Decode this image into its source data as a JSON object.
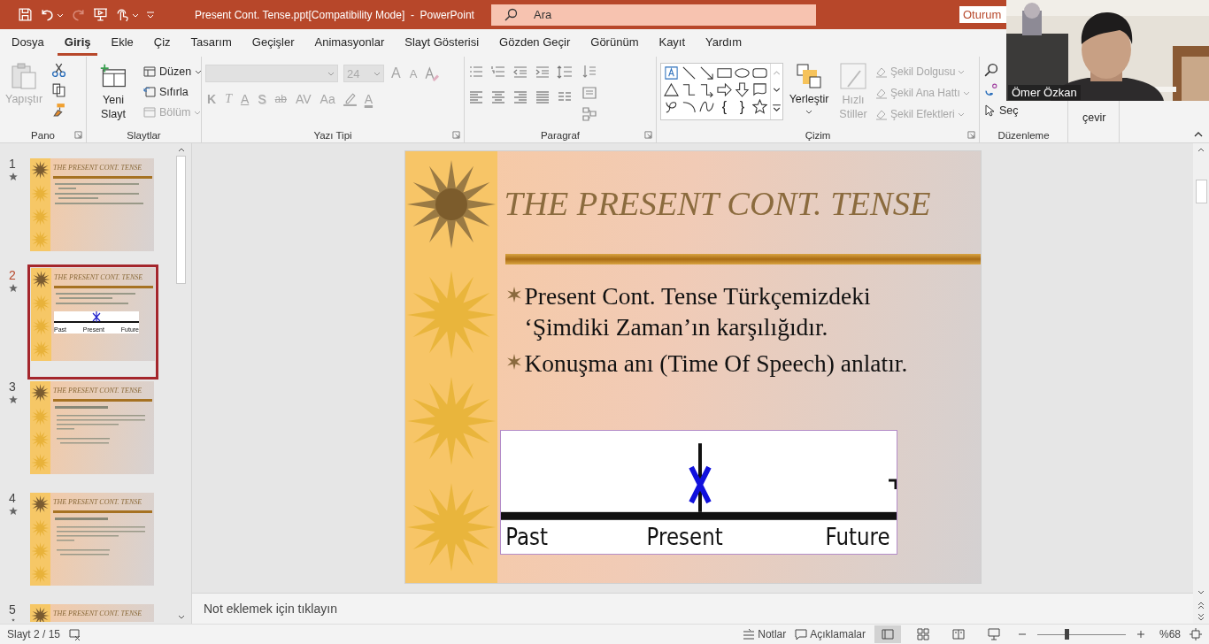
{
  "title_bar": {
    "document_title": "Present Cont. Tense.ppt[Compatibility Mode]  -  PowerPoint",
    "search": {
      "placeholder": "Ara"
    },
    "sign_in": "Oturum"
  },
  "webcam": {
    "kind": "picture",
    "name": "Ömer Özkan"
  },
  "tabs": [
    {
      "label": "Dosya",
      "selected": false
    },
    {
      "label": "Giriş",
      "selected": true
    },
    {
      "label": "Ekle",
      "selected": false
    },
    {
      "label": "Çiz",
      "selected": false
    },
    {
      "label": "Tasarım",
      "selected": false
    },
    {
      "label": "Geçişler",
      "selected": false
    },
    {
      "label": "Animasyonlar",
      "selected": false
    },
    {
      "label": "Slayt Gösterisi",
      "selected": false
    },
    {
      "label": "Gözden Geçir",
      "selected": false
    },
    {
      "label": "Görünüm",
      "selected": false
    },
    {
      "label": "Kayıt",
      "selected": false
    },
    {
      "label": "Yardım",
      "selected": false
    }
  ],
  "ribbon": {
    "pano": {
      "label": "Pano",
      "paste": {
        "label": "Yapıştır",
        "disabled": true
      }
    },
    "slaytlar": {
      "label": "Slaytlar",
      "new_slide": "Yeni Slayt",
      "layout": {
        "label": "Düzen",
        "disabled": false
      },
      "reset": {
        "label": "Sıfırla",
        "disabled": false
      },
      "section": {
        "label": "Bölüm",
        "disabled": true
      }
    },
    "yazi_tipi": {
      "label": "Yazı Tipi",
      "disabled": true,
      "font_size": "24",
      "grow": "A",
      "shrink": "A",
      "format": [
        {
          "label": "K",
          "kind": "bold"
        },
        {
          "label": "T",
          "kind": "italic"
        },
        {
          "label": "A",
          "kind": "underline"
        },
        {
          "label": "S",
          "kind": "shadow"
        },
        {
          "label": "ab",
          "kind": "strike"
        },
        {
          "label": "AV",
          "kind": "spacing"
        },
        {
          "label": "Aa",
          "kind": "case"
        }
      ],
      "font_color": "A"
    },
    "paragraf": {
      "label": "Paragraf"
    },
    "cizim": {
      "label": "Çizim",
      "braces": [
        "{",
        "}"
      ],
      "arrange": "Yerleştir",
      "quick_styles": {
        "label": "Hızlı Stiller",
        "disabled": true
      },
      "shape_options": [
        {
          "label": "Şekil Dolgusu",
          "disabled": true
        },
        {
          "label": "Şekil Ana Hattı",
          "disabled": true
        },
        {
          "label": "Şekil Efektleri",
          "disabled": true
        }
      ]
    },
    "duzenleme": {
      "label": "Düzenleme",
      "select": "Seç"
    },
    "extra": {
      "label": "çevir"
    }
  },
  "slides_panel": {
    "slides": [
      {
        "number": "1",
        "selected": false,
        "title": "THE PRESENT CONT. TENSE",
        "kind": "bullets"
      },
      {
        "number": "2",
        "selected": true,
        "title": "THE PRESENT CONT. TENSE",
        "kind": "timeline",
        "timeline": [
          "Past",
          "Present",
          "Future"
        ]
      },
      {
        "number": "3",
        "selected": false,
        "title": "THE PRESENT CONT. TENSE",
        "kind": "table"
      },
      {
        "number": "4",
        "selected": false,
        "title": "THE PRESENT CONT. TENSE",
        "kind": "table"
      },
      {
        "number": "5",
        "selected": false,
        "title": "THE PRESENT CONT. TENSE"
      }
    ]
  },
  "slide": {
    "title": "THE PRESENT CONT. TENSE",
    "bullets": [
      "Present Cont. Tense Türkçemizdeki ‘Şimdiki Zaman’ın karşılığıdır.",
      "Konuşma anı (Time Of Speech) anlatır."
    ],
    "timeline": [
      "Past",
      "Present",
      "Future"
    ]
  },
  "notes": {
    "placeholder": "Not eklemek için tıklayın"
  },
  "status_bar": {
    "slide_indicator": "Slayt 2 / 15",
    "notes": "Notlar",
    "comments": "Açıklamalar",
    "views": [
      {
        "selected": true
      },
      {
        "selected": false
      },
      {
        "selected": false
      },
      {
        "selected": false
      }
    ],
    "zoom": {
      "level": 0.33,
      "label": "%68"
    }
  }
}
